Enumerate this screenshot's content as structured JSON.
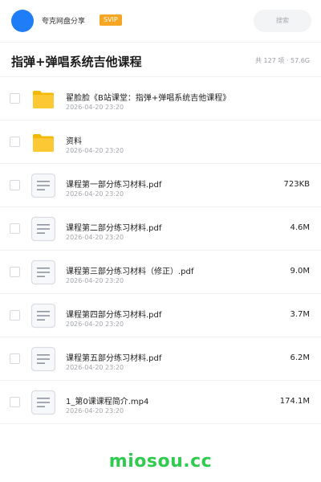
{
  "header": {
    "app_name": "夸克网盘分享",
    "badge": "SVIP",
    "search_placeholder": "搜索"
  },
  "folder": {
    "title": "指弹+弹唱系统吉他课程",
    "summary": "共 127 项 · 57.6G"
  },
  "items": [
    {
      "type": "folder-icon",
      "name": "翟脸脸《B站课堂：指弹+弹唱系统吉他课程》",
      "date": "2026-04-20 23:20",
      "size": ""
    },
    {
      "type": "folder-icon",
      "name": "资料",
      "date": "2026-04-20 23:20",
      "size": ""
    },
    {
      "type": "document-icon",
      "name": "课程第一部分练习材料.pdf",
      "date": "2026-04-20 23:20",
      "size": "723KB"
    },
    {
      "type": "document-icon",
      "name": "课程第二部分练习材料.pdf",
      "date": "2026-04-20 23:20",
      "size": "4.6M"
    },
    {
      "type": "document-icon",
      "name": "课程第三部分练习材料（修正）.pdf",
      "date": "2026-04-20 23:20",
      "size": "9.0M"
    },
    {
      "type": "document-icon",
      "name": "课程第四部分练习材料.pdf",
      "date": "2026-04-20 23:20",
      "size": "3.7M"
    },
    {
      "type": "document-icon",
      "name": "课程第五部分练习材料.pdf",
      "date": "2026-04-20 23:20",
      "size": "6.2M"
    },
    {
      "type": "document-icon",
      "name": "1_第0课课程简介.mp4",
      "date": "2026-04-20 23:20",
      "size": "174.1M"
    }
  ],
  "watermark": "miosou.cc",
  "colors": {
    "accent": "#1f7df7",
    "badge": "#f6a623",
    "folder": "#fcc934",
    "watermark": "#2ecb4e"
  }
}
